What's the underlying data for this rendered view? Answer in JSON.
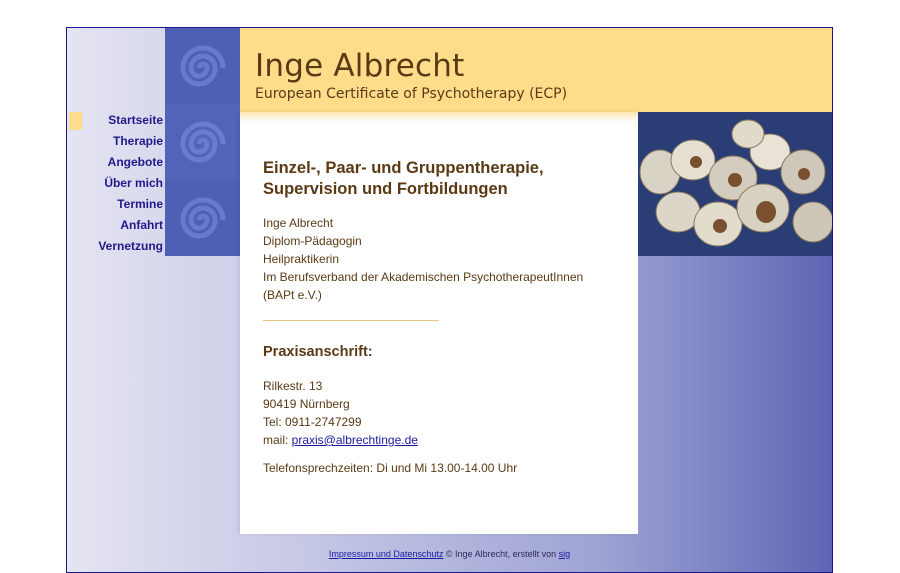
{
  "header": {
    "title": "Inge Albrecht",
    "subtitle": "European Certificate of Psychotherapy (ECP)"
  },
  "nav": {
    "items": [
      {
        "label": "Startseite"
      },
      {
        "label": "Therapie"
      },
      {
        "label": "Angebote"
      },
      {
        "label": "Über mich"
      },
      {
        "label": "Termine"
      },
      {
        "label": "Anfahrt"
      },
      {
        "label": "Vernetzung"
      }
    ]
  },
  "content": {
    "headline_line1": "Einzel-, Paar- und Gruppentherapie,",
    "headline_line2": "Supervision und Fortbildungen",
    "bio": [
      "Inge Albrecht",
      "Diplom-Pädagogin",
      "Heilpraktikerin",
      "Im Berufsverband der Akademischen PsychotherapeutInnen",
      "(BAPt e.V.)"
    ],
    "address_heading": "Praxisanschrift:",
    "street": "Rilkestr. 13",
    "city": "90419 Nürnberg",
    "phone": "Tel: 0911-2747299",
    "mail_prefix": "mail: ",
    "mail_link": "praxis@albrechtinge.de",
    "hours": "Telefonsprechzeiten: Di und Mi 13.00-14.00 Uhr"
  },
  "footer": {
    "imprint_link": "Impressum und Datenschutz",
    "copyright": " © Inge Albrecht,  erstellt von ",
    "author_link": "sig"
  },
  "icons": [
    "swirl-ornament",
    "snail-photo"
  ],
  "colors": {
    "header_bg": "#fddc8a",
    "text_brown": "#5a3a14",
    "nav_text": "#1f1a8a",
    "frame_border": "#1a1a8c"
  }
}
